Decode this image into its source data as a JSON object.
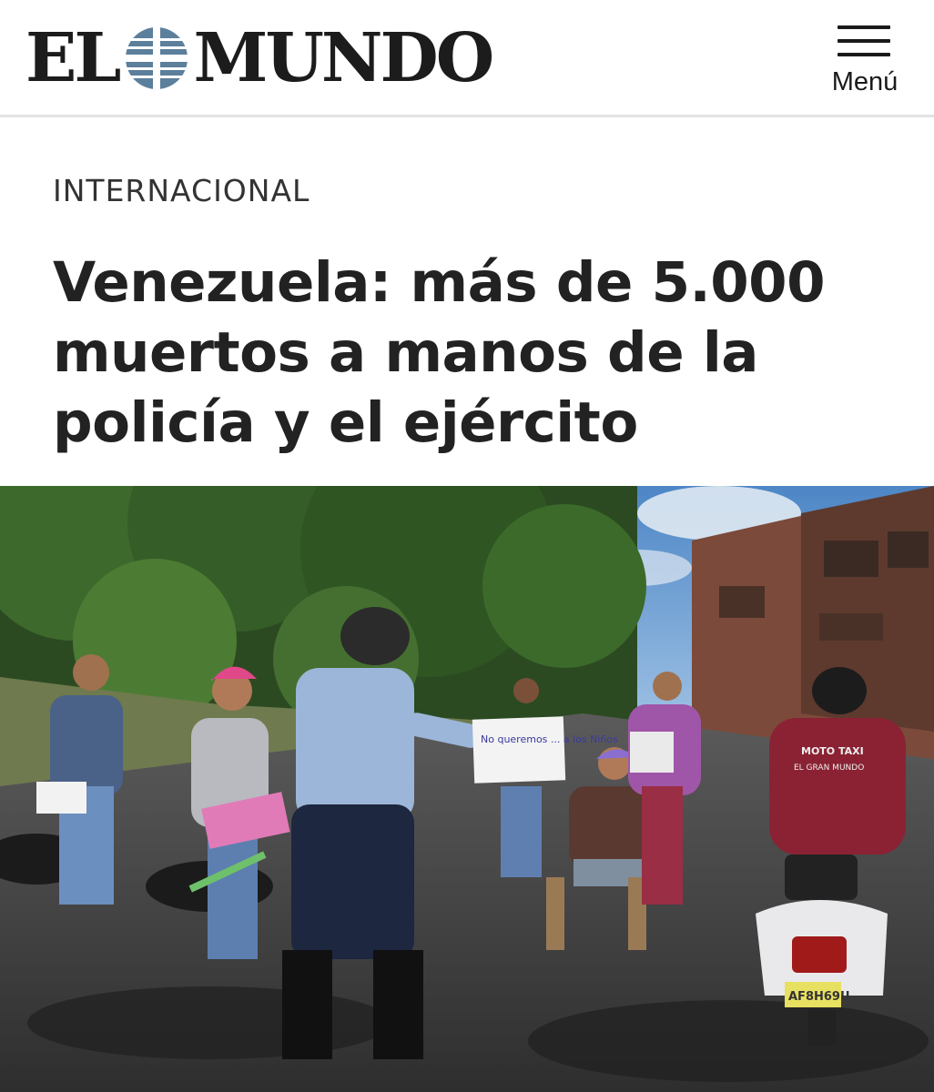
{
  "header": {
    "logo": {
      "left": "EL",
      "right": "MUNDO"
    },
    "menu_label": "Menú"
  },
  "article": {
    "section": "INTERNACIONAL",
    "headline": "Venezuela: más de 5.000 muertos a manos de la policía y el ejército"
  },
  "photo": {
    "sign_text": "No queremos ... a los Niños",
    "jacket_text_1": "MOTO TAXI",
    "jacket_text_2": "EL GRAN MUNDO",
    "plate": "AF8H69U"
  },
  "colors": {
    "background": "#ffffff",
    "text": "#222222",
    "logo_globe": "#5c7f9c",
    "rule": "#e3e3e3"
  }
}
